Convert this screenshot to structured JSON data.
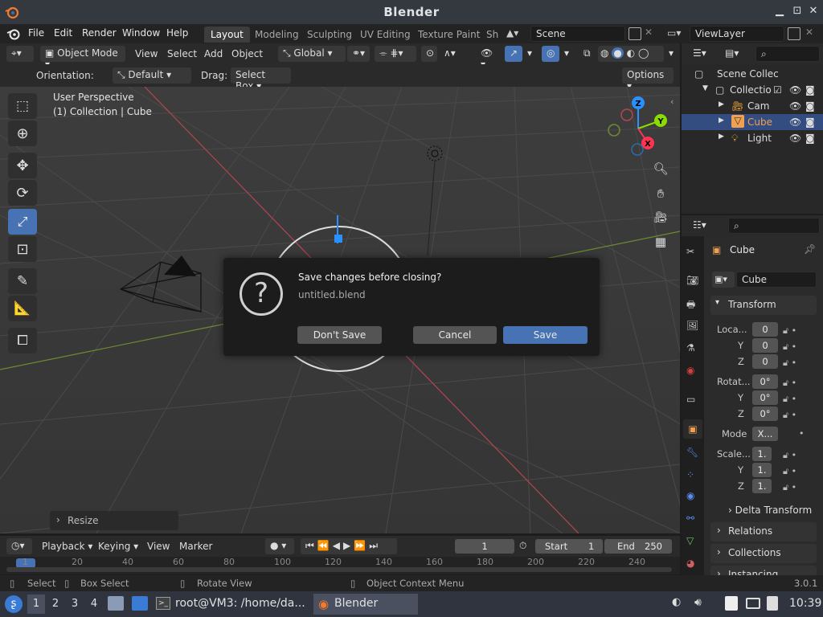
{
  "window": {
    "title": "Blender"
  },
  "menubar": {
    "items": [
      "File",
      "Edit",
      "Render",
      "Window",
      "Help"
    ],
    "workspaces": [
      "Layout",
      "Modeling",
      "Sculpting",
      "UV Editing",
      "Texture Paint",
      "Sh"
    ],
    "active_workspace": "Layout",
    "scene": "Scene",
    "view_layer": "ViewLayer"
  },
  "header3d": {
    "mode": "Object Mode",
    "menus": [
      "View",
      "Select",
      "Add",
      "Object"
    ],
    "transform_orientation": "Global"
  },
  "tool_settings": {
    "orientation_label": "Orientation:",
    "orientation_value": "Default",
    "drag_label": "Drag:",
    "drag_value": "Select Box",
    "options_label": "Options"
  },
  "viewport": {
    "view_name": "User Perspective",
    "context": "(1) Collection | Cube",
    "gizmo_axes": {
      "z": "Z",
      "y": "Y",
      "x": "X"
    }
  },
  "outliner": {
    "rows": [
      {
        "label": "Scene Collec"
      },
      {
        "label": "Collectio"
      },
      {
        "label": "Cam"
      },
      {
        "label": "Cube"
      },
      {
        "label": "Light"
      }
    ]
  },
  "properties": {
    "object_name": "Cube",
    "data_name": "Cube",
    "transform_title": "Transform",
    "location_label": "Loca...",
    "rotation_label": "Rotat...",
    "scale_label": "Scale...",
    "axis_y": "Y",
    "axis_z": "Z",
    "location": [
      "0",
      "0",
      "0"
    ],
    "rotation": [
      "0°",
      "0°",
      "0°"
    ],
    "mode_label": "Mode",
    "mode_value": "X...",
    "scale": [
      "1.",
      "1.",
      "1."
    ],
    "sections": [
      "Delta Transform",
      "Relations",
      "Collections",
      "Instancing"
    ]
  },
  "dialog": {
    "title": "Save changes before closing?",
    "filename": "untitled.blend",
    "dont_save": "Don't Save",
    "cancel": "Cancel",
    "save": "Save"
  },
  "resize_panel": {
    "label": "Resize"
  },
  "timeline": {
    "menus": [
      "Playback",
      "Keying",
      "View",
      "Marker"
    ],
    "current_frame": "1",
    "start_label": "Start",
    "start": "1",
    "end_label": "End",
    "end": "250",
    "ruler_ticks": [
      "1",
      "20",
      "40",
      "60",
      "80",
      "100",
      "120",
      "140",
      "160",
      "180",
      "200",
      "220",
      "240"
    ]
  },
  "statusbar": {
    "select": "Select",
    "box_select": "Box Select",
    "rotate_view": "Rotate View",
    "context_menu": "Object Context Menu",
    "version": "3.0.1"
  },
  "taskbar": {
    "workspaces": [
      "1",
      "2",
      "3",
      "4"
    ],
    "terminal_title": "root@VM3: /home/da...",
    "blender_title": "Blender",
    "clock": "10:39"
  },
  "colors": {
    "accent": "#4772b3",
    "selection": "#334d80",
    "axis_x": "#ff3352",
    "axis_y": "#8bdc00",
    "axis_z": "#2890ff"
  }
}
